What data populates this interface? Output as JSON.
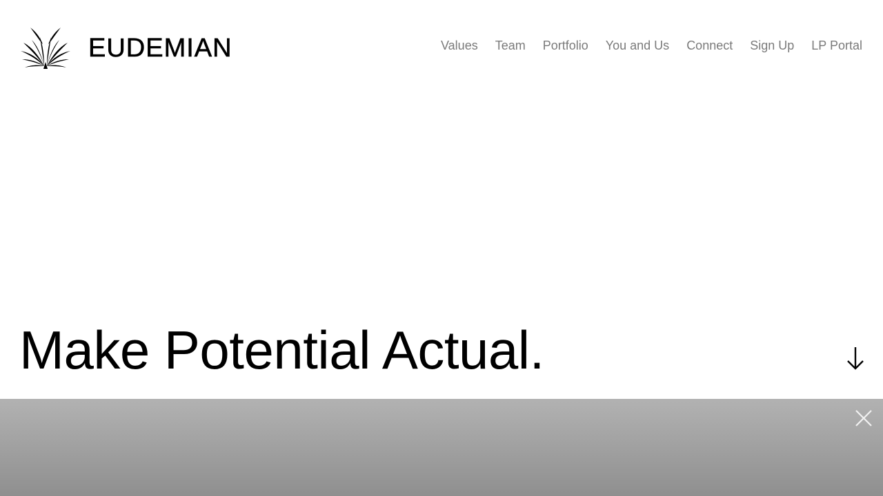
{
  "brand": {
    "name": "EUDEMIAN",
    "logo_icon": "winged-emblem-icon"
  },
  "nav": {
    "items": [
      {
        "label": "Values"
      },
      {
        "label": "Team"
      },
      {
        "label": "Portfolio"
      },
      {
        "label": "You and Us"
      },
      {
        "label": "Connect"
      },
      {
        "label": "Sign Up"
      },
      {
        "label": "LP Portal"
      }
    ],
    "color": "#7a7a7a"
  },
  "hero": {
    "title": "Make Potential Actual.",
    "scroll_icon": "arrow-down-icon"
  },
  "banner": {
    "close_icon": "close-icon",
    "gradient_top": "#b2b2b2",
    "gradient_bottom": "#8f8f8f"
  }
}
